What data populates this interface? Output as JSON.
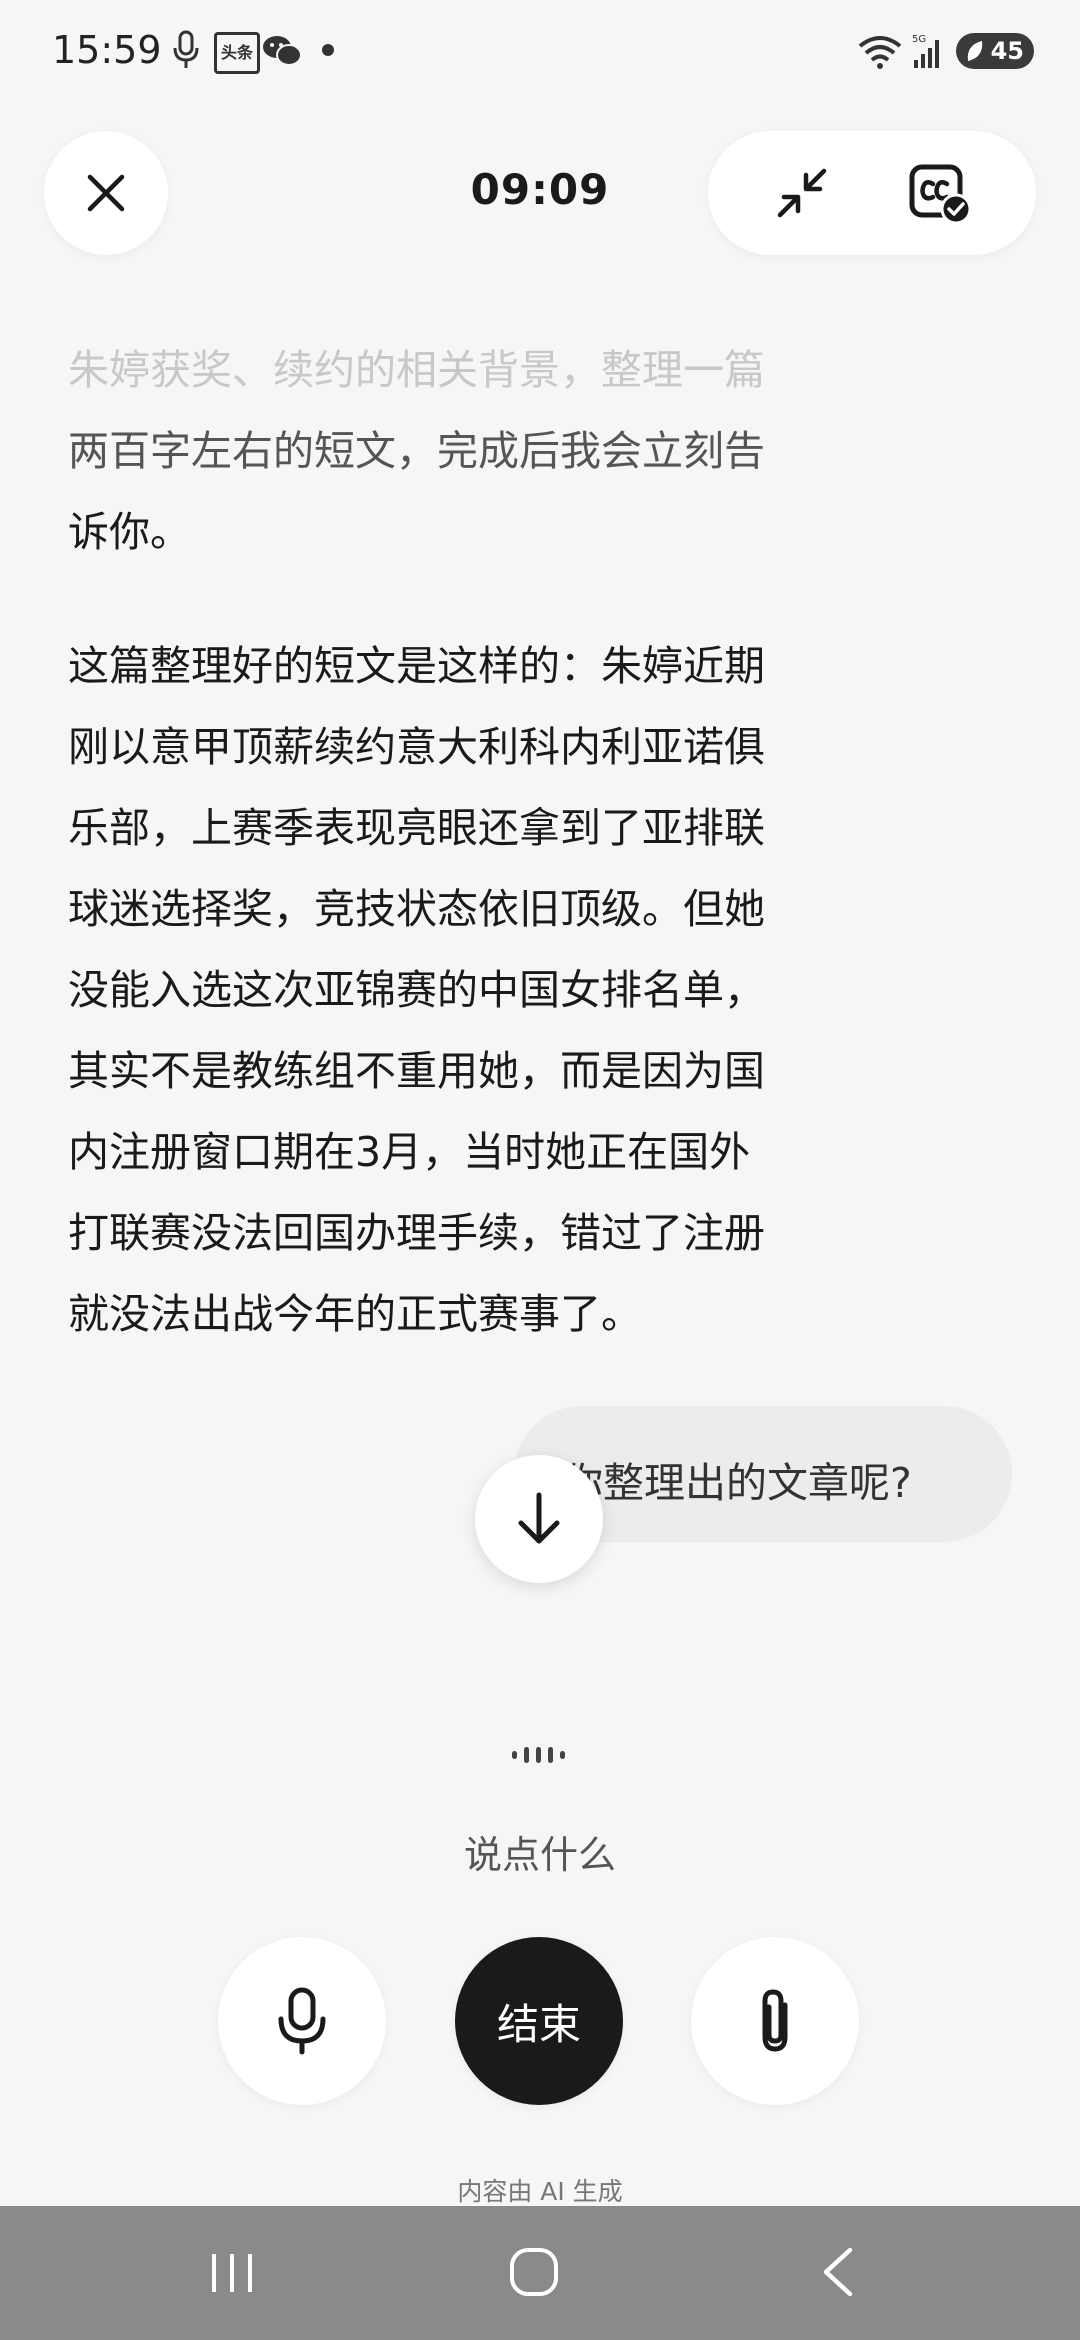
{
  "status_bar": {
    "time": "15:59",
    "news_app_label": "头条",
    "battery": "45",
    "icons": [
      "microphone-icon",
      "news-app-icon",
      "wechat-icon",
      "dot-icon",
      "wifi-icon",
      "signal-5g-icon",
      "battery-icon"
    ]
  },
  "header": {
    "timer": "09:09",
    "close_icon": "close-icon",
    "minimize_icon": "minimize-icon",
    "caption_icon": "caption-icon"
  },
  "messages": {
    "assistant_prev": {
      "line1": "朱婷获奖、续约的相关背景，整理一篇",
      "line2": "两百字左右的短文，完成后我会立刻告",
      "line3": "诉你。"
    },
    "assistant_article": {
      "lines": [
        "这篇整理好的短文是这样的：朱婷近期",
        "刚以意甲顶薪续约意大利科内利亚诺俱",
        "乐部，上赛季表现亮眼还拿到了亚排联",
        "球迷选择奖，竞技状态依旧顶级。但她",
        "没能入选这次亚锦赛的中国女排名单，",
        "其实不是教练组不重用她，而是因为国",
        "内注册窗口期在3月，当时她正在国外",
        "打联赛没法回国办理手续，错过了注册",
        "就没法出战今年的正式赛事了。"
      ]
    },
    "user": {
      "text": "你整理出的文章呢?"
    }
  },
  "voice": {
    "prompt": "说点什么",
    "end_label": "结束",
    "ai_note": "内容由 AI 生成"
  },
  "colors": {
    "background": "#f7f6f5",
    "end_button": "#1a1a1a",
    "bubble": "#ececeb",
    "navbar": "#8a8a8a"
  }
}
